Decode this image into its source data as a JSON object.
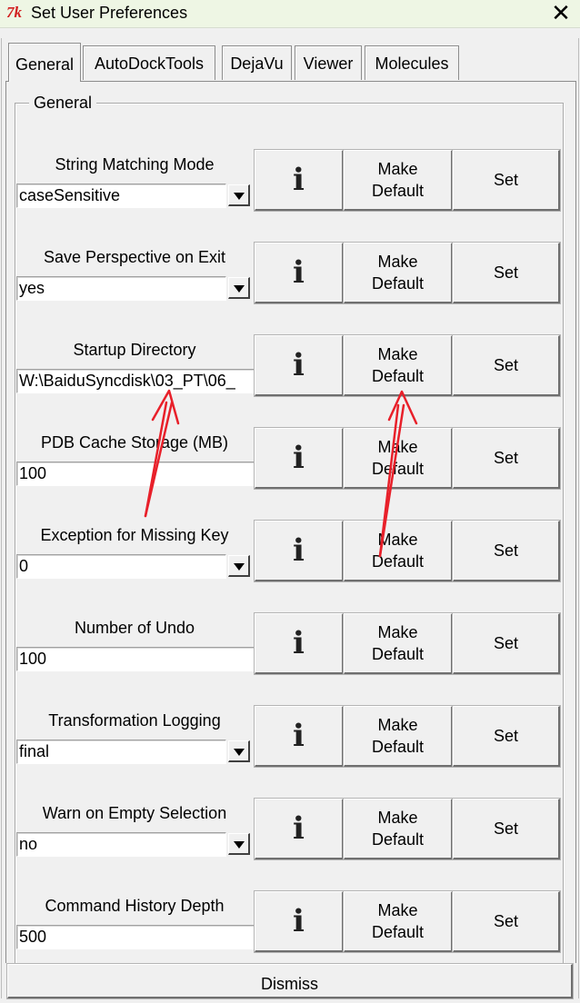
{
  "window": {
    "title": "Set User Preferences",
    "app_icon_text": "7k"
  },
  "tabs": [
    "General",
    "AutoDockTools",
    "DejaVu",
    "Viewer",
    "Molecules"
  ],
  "group_label": "General",
  "info_glyph": "i",
  "prefs": [
    {
      "label": "String Matching Mode",
      "value": "caseSensitive",
      "widget": "combo",
      "make_default": "Make\nDefault",
      "set": "Set"
    },
    {
      "label": "Save Perspective on Exit",
      "value": "yes",
      "widget": "combo",
      "make_default": "Make\nDefault",
      "set": "Set"
    },
    {
      "label": "Startup Directory",
      "value": "W:\\BaiduSyncdisk\\03_PT\\06_",
      "widget": "text",
      "make_default": "Make\nDefault",
      "set": "Set"
    },
    {
      "label": "PDB Cache Storage (MB)",
      "value": "100",
      "widget": "text",
      "make_default": "Make\nDefault",
      "set": "Set"
    },
    {
      "label": "Exception for Missing Key",
      "value": "0",
      "widget": "combo",
      "make_default": "Make\nDefault",
      "set": "Set"
    },
    {
      "label": "Number of Undo",
      "value": "100",
      "widget": "text",
      "make_default": "Make\nDefault",
      "set": "Set"
    },
    {
      "label": "Transformation Logging",
      "value": "final",
      "widget": "combo",
      "make_default": "Make\nDefault",
      "set": "Set"
    },
    {
      "label": "Warn on Empty Selection",
      "value": "no",
      "widget": "combo",
      "make_default": "Make\nDefault",
      "set": "Set"
    },
    {
      "label": "Command History Depth",
      "value": "500",
      "widget": "text",
      "make_default": "Make\nDefault",
      "set": "Set"
    }
  ],
  "dismiss_label": "Dismiss",
  "annotation_color": "#e8202a"
}
